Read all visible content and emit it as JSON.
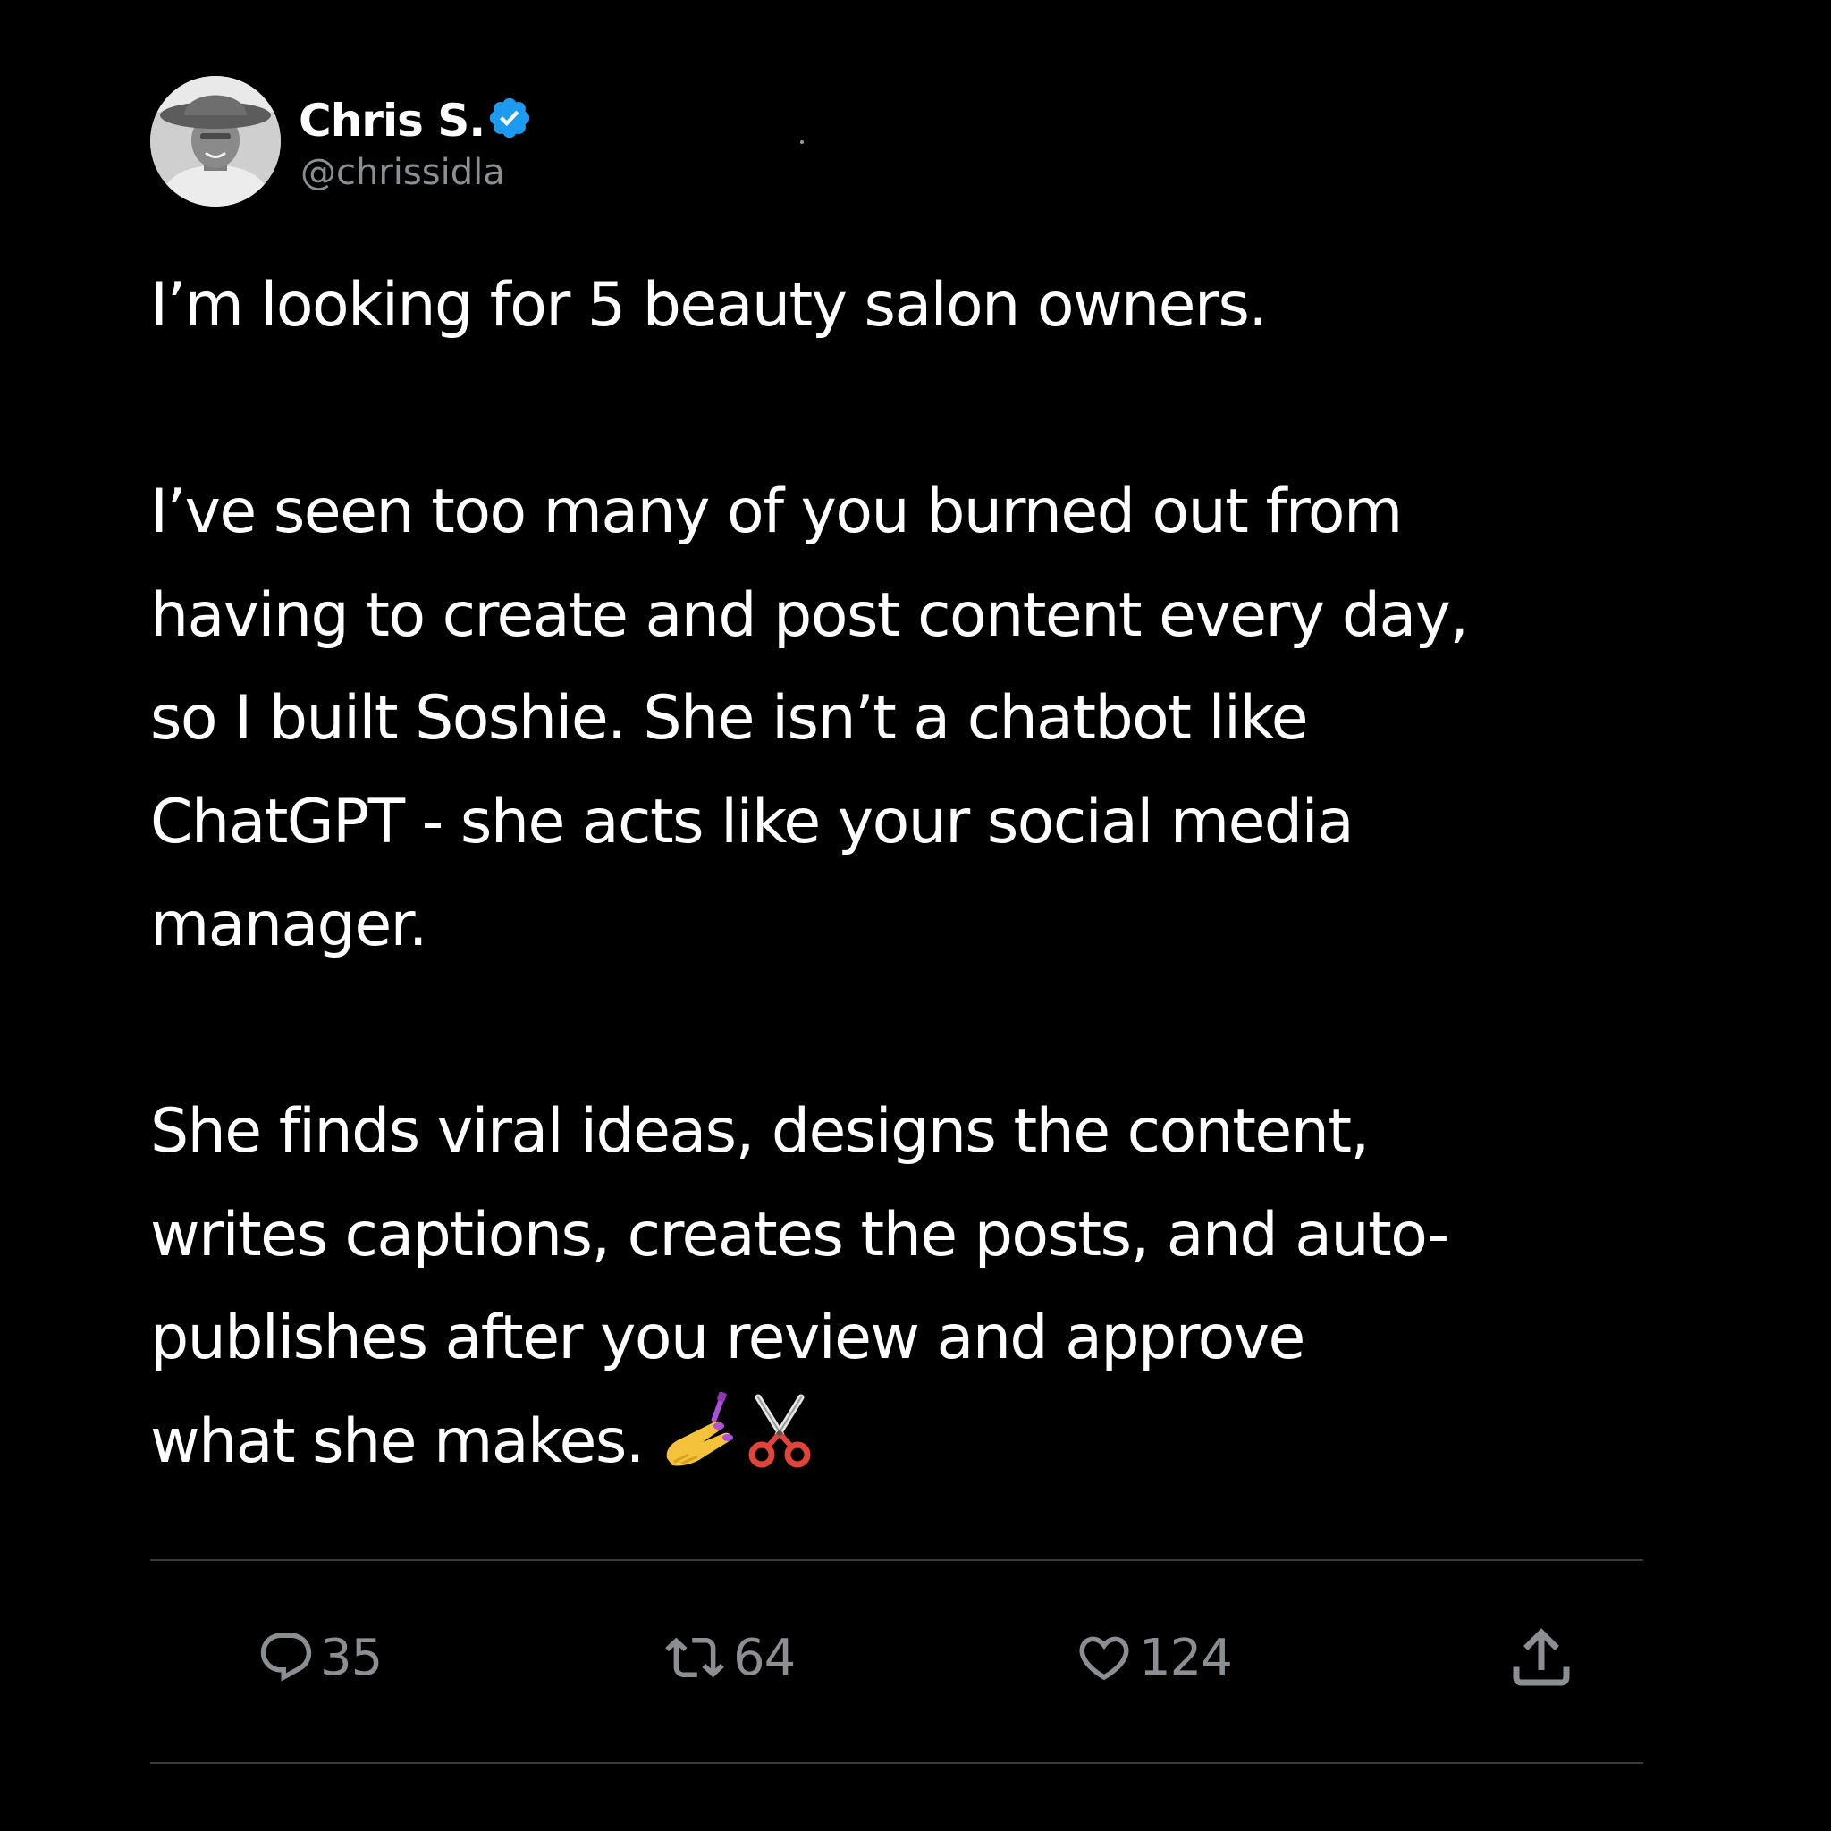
{
  "author": {
    "display_name": "Chris S.",
    "handle": "@chrissidla",
    "verified": true
  },
  "tweet": {
    "paragraphs": [
      [
        "I’m looking for 5 beauty salon owners."
      ],
      [
        "I’ve seen too many of you burned out from",
        "having to create and post content every day,",
        "so I built Soshie. She isn’t a chatbot like",
        "ChatGPT - she acts like your social media",
        "manager."
      ],
      [
        "She finds viral ideas, designs the content,",
        "writes captions, creates the posts, and auto-",
        "publishes after you review and approve",
        "what she makes. "
      ]
    ],
    "emoji": [
      "nail-polish-emoji",
      "scissors-emoji"
    ]
  },
  "actions": {
    "replies": "35",
    "retweets": "64",
    "likes": "124"
  },
  "colors": {
    "background": "#000000",
    "text": "#ffffff",
    "secondary": "#8b8f94",
    "verified": "#1d9bf0",
    "divider": "#3a3a3a"
  }
}
